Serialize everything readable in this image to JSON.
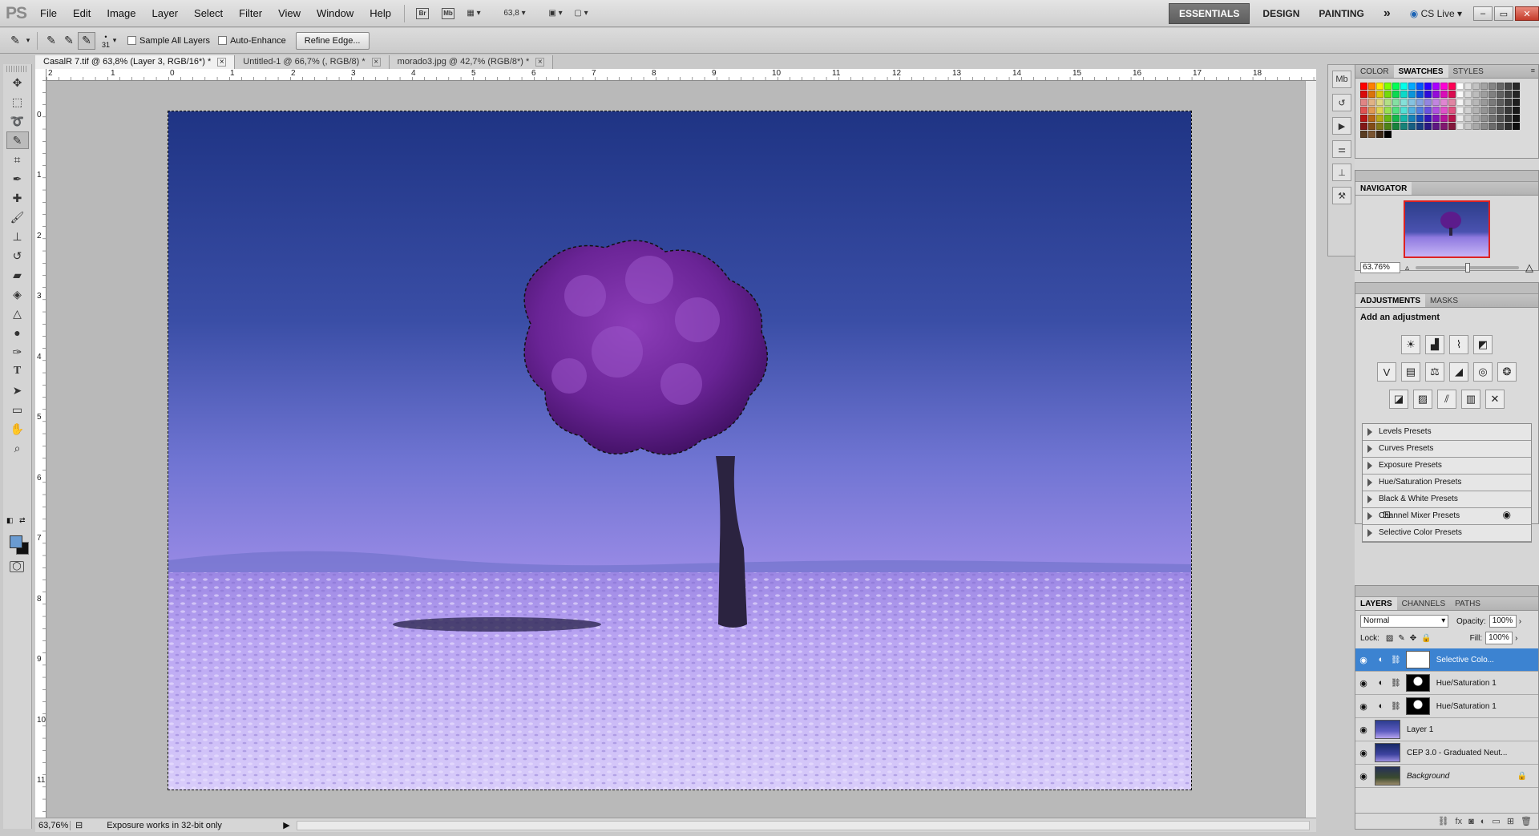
{
  "app": {
    "logo": "PS"
  },
  "menu": {
    "items": [
      "File",
      "Edit",
      "Image",
      "Layer",
      "Select",
      "Filter",
      "View",
      "Window",
      "Help"
    ]
  },
  "menubar": {
    "bridge": "Br",
    "mini_bridge": "Mb",
    "zoom": "63,8",
    "workspaces": [
      "ESSENTIALS",
      "DESIGN",
      "PAINTING"
    ],
    "more": "»",
    "cs_live": "CS Live",
    "window_controls": {
      "minimize": "–",
      "restore": "▭",
      "close": "✕"
    }
  },
  "options": {
    "brush_size": "31",
    "sample_all_layers": "Sample All Layers",
    "auto_enhance": "Auto-Enhance",
    "refine_edge": "Refine Edge..."
  },
  "doc_tabs": [
    {
      "label": "CasalR 7.tif @ 63,8% (Layer 3, RGB/16*) *"
    },
    {
      "label": "Untitled-1 @ 66,7% (, RGB/8) *"
    },
    {
      "label": "morado3.jpg @ 42,7% (RGB/8*) *"
    }
  ],
  "ruler": {
    "h": [
      "2",
      "1",
      "0",
      "1",
      "2",
      "3",
      "4",
      "5",
      "6",
      "7",
      "8",
      "9",
      "10",
      "11",
      "12",
      "13",
      "14",
      "15",
      "16",
      "17",
      "18"
    ],
    "v": [
      "0",
      "1",
      "2",
      "3",
      "4",
      "5",
      "6",
      "7",
      "8",
      "9",
      "10",
      "11"
    ]
  },
  "status": {
    "zoom": "63,76%",
    "info": "Exposure works in 32-bit only"
  },
  "panels": {
    "swatches": {
      "tabs": [
        "COLOR",
        "SWATCHES",
        "STYLES"
      ]
    },
    "navigator": {
      "title": "NAVIGATOR",
      "zoom": "63.76%"
    },
    "adjustments": {
      "tabs": [
        "ADJUSTMENTS",
        "MASKS"
      ],
      "title": "Add an adjustment",
      "presets": [
        "Levels Presets",
        "Curves Presets",
        "Exposure Presets",
        "Hue/Saturation Presets",
        "Black & White Presets",
        "Channel Mixer Presets",
        "Selective Color Presets"
      ]
    },
    "layers": {
      "tabs": [
        "LAYERS",
        "CHANNELS",
        "PATHS"
      ],
      "blend_mode": "Normal",
      "opacity_label": "Opacity:",
      "opacity": "100%",
      "lock_label": "Lock:",
      "fill_label": "Fill:",
      "fill": "100%",
      "items": [
        {
          "name": "Selective Colo..."
        },
        {
          "name": "Hue/Saturation 1"
        },
        {
          "name": "Hue/Saturation 1"
        },
        {
          "name": "Layer 1"
        },
        {
          "name": "CEP 3.0 - Graduated Neut..."
        },
        {
          "name": "Background"
        }
      ]
    }
  },
  "colors": {
    "accent": "#3c83d1",
    "foreground": "#6a9bd1",
    "background": "#111111"
  }
}
